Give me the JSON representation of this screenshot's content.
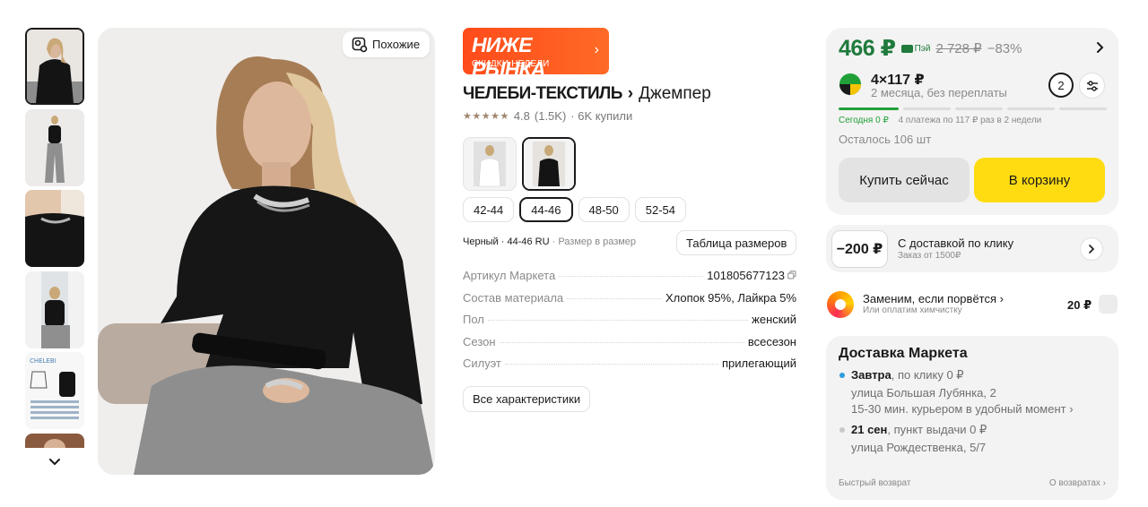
{
  "gallery": {
    "similar_label": "Похожие",
    "thumb_count": 6
  },
  "promo": {
    "title": "НИЖЕ РЫНКА",
    "subtitle": "СКИДКИ НЕДЕЛИ",
    "chevron": "›"
  },
  "product": {
    "brand": "ЧЕЛЕБИ-ТЕКСТИЛЬ",
    "brand_chevron": "›",
    "name": "Джемпер",
    "stars": "★★★★★",
    "rating": "4.8",
    "reviews": "(1.5K)",
    "sold": "· 6K купили",
    "colors": [
      "white",
      "black"
    ],
    "sizes": [
      "42-44",
      "44-46",
      "48-50",
      "52-54"
    ],
    "selected_size": "44-46",
    "variant_info": "Черный · 44-46 RU",
    "variant_fit": "· Размер в размер",
    "size_table_label": "Таблица размеров",
    "specs": [
      {
        "key": "Артикул Маркета",
        "value": "101805677123"
      },
      {
        "key": "Состав материала",
        "value": "Хлопок 95%, Лайкра 5%"
      },
      {
        "key": "Пол",
        "value": "женский"
      },
      {
        "key": "Сезон",
        "value": "всесезон"
      },
      {
        "key": "Силуэт",
        "value": "прилегающий"
      }
    ],
    "all_specs_label": "Все характеристики"
  },
  "buy": {
    "price": "466 ₽",
    "pay_label": "Пэй",
    "old_price": "2 728 ₽",
    "discount": "−83%",
    "split_main": "4×117 ₽",
    "split_sub": "2 месяца, без переплаты",
    "split_count": "2",
    "plan_today": "Сегодня 0 ₽",
    "plan_rest": "4 платежа по 117 ₽ раз в 2 недели",
    "stock": "Осталось 106 шт",
    "buy_now_label": "Купить сейчас",
    "cart_label": "В корзину",
    "colors": {
      "price": "#1f7a3c",
      "cart": "#ffdc12",
      "split": "#21a038"
    }
  },
  "delivery_promo": {
    "badge": "−200 ₽",
    "title": "С доставкой по клику",
    "subtitle": "Заказ от 1500₽"
  },
  "insurance": {
    "title": "Заменим, если порвётся ›",
    "subtitle": "Или оплатим химчистку",
    "price": "20 ₽"
  },
  "shipping": {
    "title": "Доставка Маркета",
    "options": [
      {
        "day": "Завтра",
        "detail": ", по клику  0 ₽",
        "address": "улица Большая Лубянка, 2",
        "note": "15-30 мин. курьером в удобный момент ›"
      },
      {
        "day": "21 сен",
        "detail": ", пункт выдачи  0 ₽",
        "address": "улица Рождественка, 5/7"
      }
    ],
    "fast_return": "Быстрый возврат",
    "returns_link": "О возвратах ›"
  }
}
